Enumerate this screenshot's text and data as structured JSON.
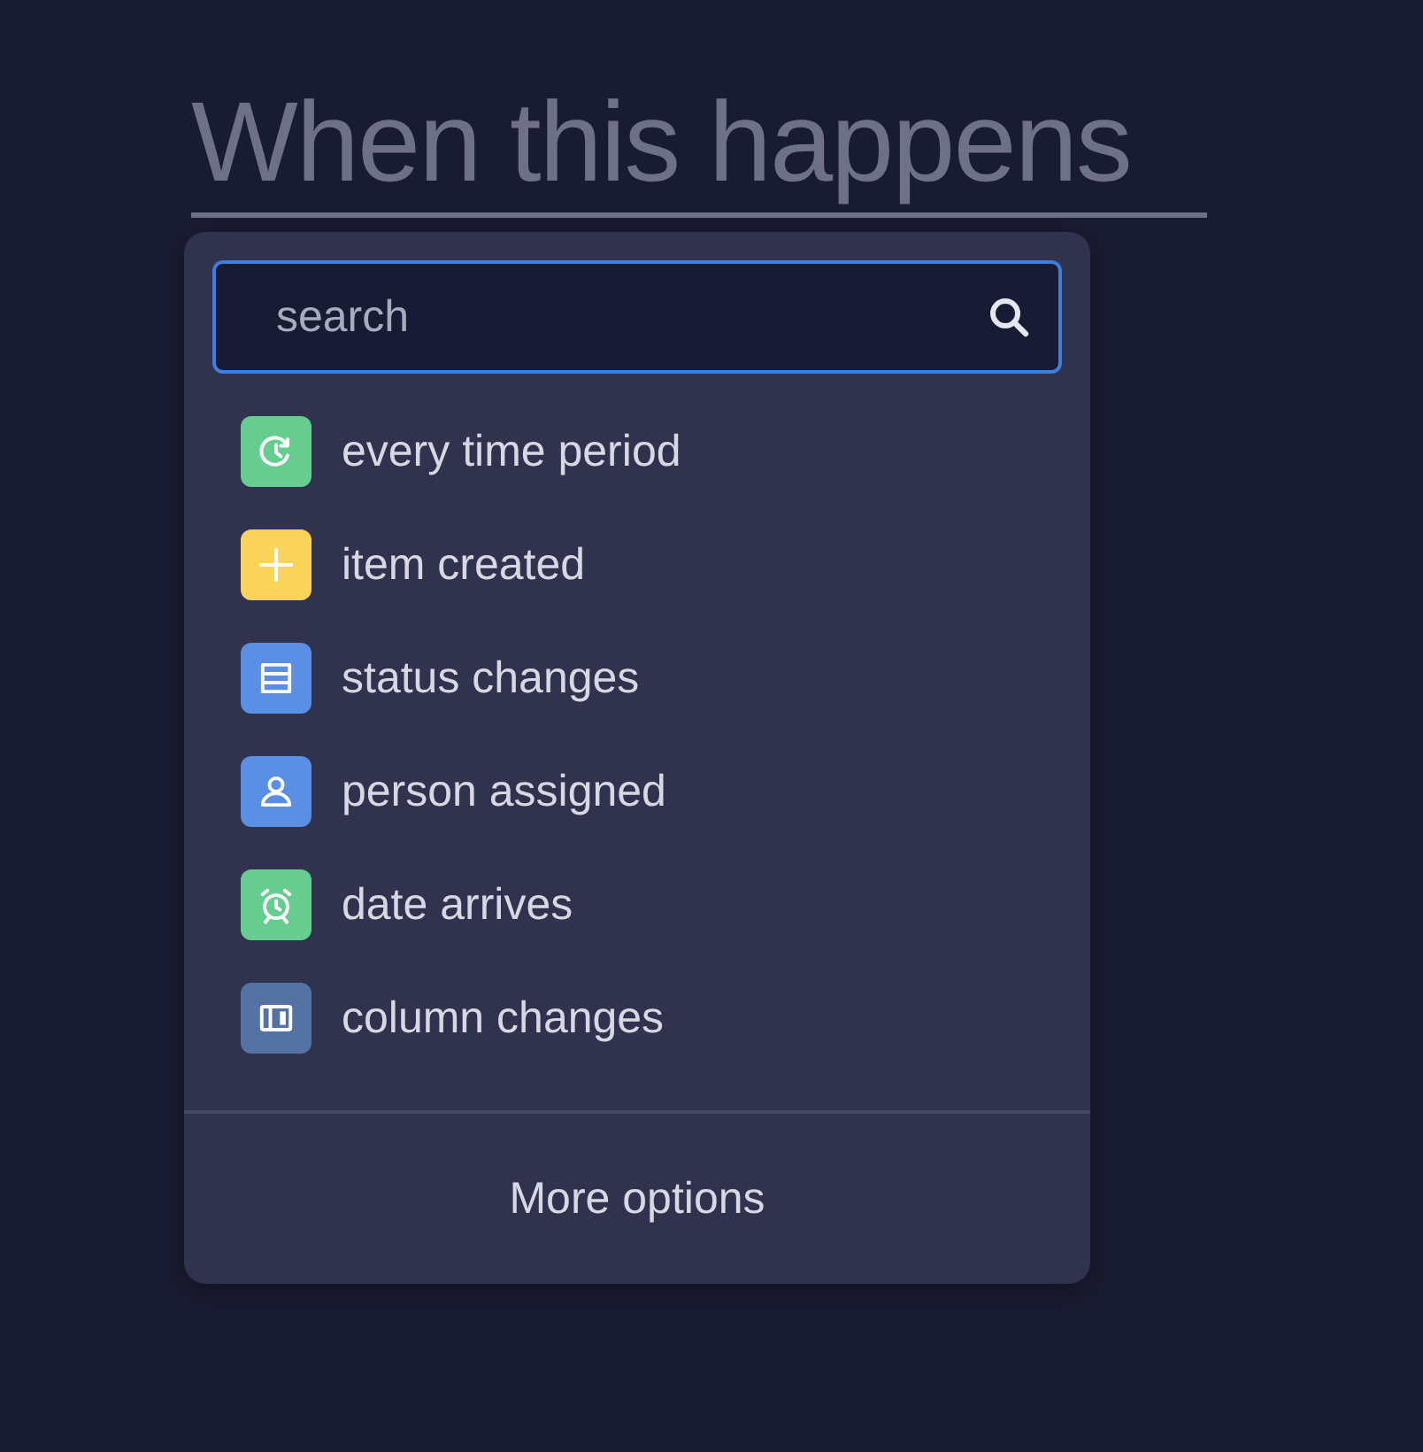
{
  "heading": "When this happens",
  "search": {
    "placeholder": "search"
  },
  "options": [
    {
      "kind": "recurring",
      "label": "every time period",
      "color": "#66cc8f"
    },
    {
      "kind": "plus",
      "label": "item created",
      "color": "#f9d35a"
    },
    {
      "kind": "status",
      "label": "status changes",
      "color": "#5b8fe6"
    },
    {
      "kind": "person",
      "label": "person assigned",
      "color": "#5b8fe6"
    },
    {
      "kind": "alarm",
      "label": "date arrives",
      "color": "#66cc8f"
    },
    {
      "kind": "column",
      "label": "column changes",
      "color": "#5472a4"
    }
  ],
  "more_options": "More options"
}
